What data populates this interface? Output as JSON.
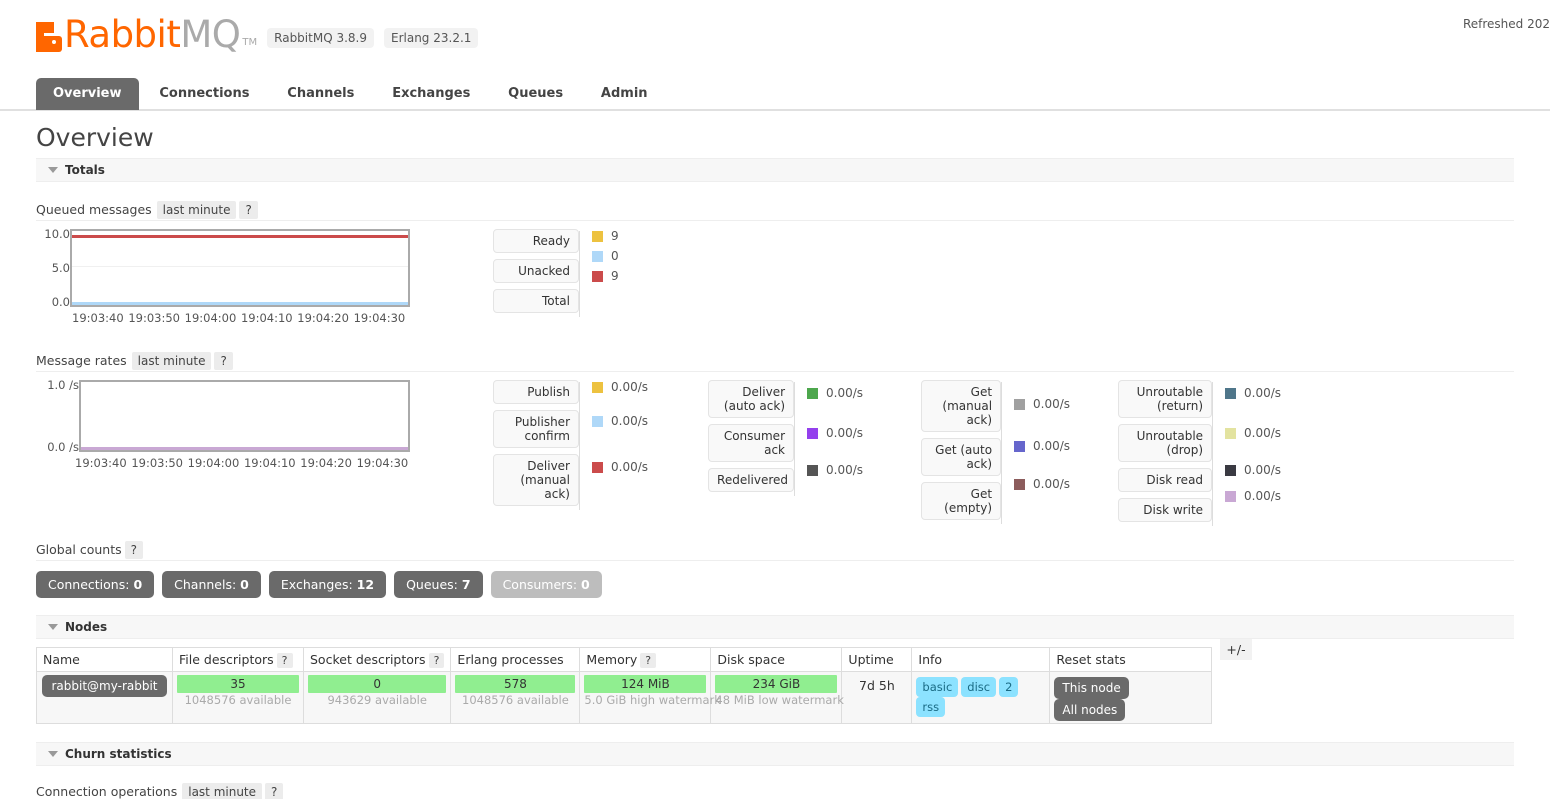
{
  "header": {
    "logo_text_primary": "Rabbit",
    "logo_text_secondary": "MQ",
    "logo_tm": "TM",
    "version_rabbitmq": "RabbitMQ 3.8.9",
    "version_erlang": "Erlang 23.2.1",
    "refreshed": "Refreshed 202"
  },
  "tabs": [
    {
      "label": "Overview",
      "active": true
    },
    {
      "label": "Connections",
      "active": false
    },
    {
      "label": "Channels",
      "active": false
    },
    {
      "label": "Exchanges",
      "active": false
    },
    {
      "label": "Queues",
      "active": false
    },
    {
      "label": "Admin",
      "active": false
    }
  ],
  "page_title": "Overview",
  "sections": {
    "totals": "Totals",
    "nodes": "Nodes",
    "churn": "Churn statistics"
  },
  "queued_messages": {
    "label": "Queued messages",
    "period": "last minute",
    "help": "?",
    "legend": [
      {
        "name": "Ready",
        "value": "9",
        "color": "#edc240"
      },
      {
        "name": "Unacked",
        "value": "0",
        "color": "#afd8f8"
      },
      {
        "name": "Total",
        "value": "9",
        "color": "#cb4b4b"
      }
    ]
  },
  "message_rates": {
    "label": "Message rates",
    "period": "last minute",
    "help": "?",
    "columns": [
      {
        "items": [
          {
            "name": "Publish",
            "value": "0.00/s",
            "color": "#edc240"
          },
          {
            "name": "Publisher\nconfirm",
            "value": "0.00/s",
            "color": "#afd8f8"
          },
          {
            "name": "Deliver\n(manual\nack)",
            "value": "0.00/s",
            "color": "#cb4b4b"
          }
        ]
      },
      {
        "items": [
          {
            "name": "Deliver\n(auto ack)",
            "value": "0.00/s",
            "color": "#4da74d"
          },
          {
            "name": "Consumer\nack",
            "value": "0.00/s",
            "color": "#9440ed"
          },
          {
            "name": "Redelivered",
            "value": "0.00/s",
            "color": "#555555"
          }
        ]
      },
      {
        "items": [
          {
            "name": "Get\n(manual\nack)",
            "value": "0.00/s",
            "color": "#a0a0a0"
          },
          {
            "name": "Get (auto\nack)",
            "value": "0.00/s",
            "color": "#6666cc"
          },
          {
            "name": "Get\n(empty)",
            "value": "0.00/s",
            "color": "#8c5c5c"
          }
        ]
      },
      {
        "items": [
          {
            "name": "Unroutable\n(return)",
            "value": "0.00/s",
            "color": "#4f768a"
          },
          {
            "name": "Unroutable\n(drop)",
            "value": "0.00/s",
            "color": "#e3e3a0"
          },
          {
            "name": "Disk read",
            "value": "0.00/s",
            "color": "#3a3a42"
          },
          {
            "name": "Disk write",
            "value": "0.00/s",
            "color": "#c9a8d4"
          }
        ]
      }
    ]
  },
  "global_counts": {
    "label": "Global counts",
    "help": "?",
    "badges": [
      {
        "label": "Connections:",
        "value": "0",
        "disabled": false
      },
      {
        "label": "Channels:",
        "value": "0",
        "disabled": false
      },
      {
        "label": "Exchanges:",
        "value": "12",
        "disabled": false
      },
      {
        "label": "Queues:",
        "value": "7",
        "disabled": false
      },
      {
        "label": "Consumers:",
        "value": "0",
        "disabled": true
      }
    ]
  },
  "nodes_table": {
    "headers": [
      {
        "label": "Name",
        "help": null
      },
      {
        "label": "File descriptors",
        "help": "?"
      },
      {
        "label": "Socket descriptors",
        "help": "?"
      },
      {
        "label": "Erlang processes",
        "help": null
      },
      {
        "label": "Memory",
        "help": "?"
      },
      {
        "label": "Disk space",
        "help": null
      },
      {
        "label": "Uptime",
        "help": null
      },
      {
        "label": "Info",
        "help": null
      },
      {
        "label": "Reset stats",
        "help": null
      }
    ],
    "expander": "+/-",
    "row": {
      "name": "rabbit@my-rabbit",
      "file_descriptors": {
        "value": "35",
        "sub": "1048576 available"
      },
      "socket_descriptors": {
        "value": "0",
        "sub": "943629 available"
      },
      "erlang_processes": {
        "value": "578",
        "sub": "1048576 available"
      },
      "memory": {
        "value": "124 MiB",
        "sub": "5.0 GiB high watermark"
      },
      "disk_space": {
        "value": "234 GiB",
        "sub": "48 MiB low watermark"
      },
      "uptime": "7d 5h",
      "info": [
        "basic",
        "disc",
        "2",
        "rss"
      ],
      "reset_stats": [
        "This node",
        "All nodes"
      ]
    }
  },
  "churn": {
    "label": "Connection operations",
    "period": "last minute",
    "help": "?"
  },
  "chart_data": [
    {
      "type": "line",
      "title": "Queued messages",
      "xlabel": "",
      "ylabel": "",
      "ylim": [
        0,
        10
      ],
      "yticks": [
        "0.0",
        "5.0",
        "10.0"
      ],
      "x": [
        "19:03:40",
        "19:03:50",
        "19:04:00",
        "19:04:10",
        "19:04:20",
        "19:04:30"
      ],
      "grid": true,
      "legend_position": "right",
      "series": [
        {
          "name": "Ready",
          "color": "#edc240",
          "values": [
            9,
            9,
            9,
            9,
            9,
            9
          ]
        },
        {
          "name": "Unacked",
          "color": "#afd8f8",
          "values": [
            0,
            0,
            0,
            0,
            0,
            0
          ]
        },
        {
          "name": "Total",
          "color": "#cb4b4b",
          "values": [
            9,
            9,
            9,
            9,
            9,
            9
          ]
        }
      ]
    },
    {
      "type": "line",
      "title": "Message rates",
      "xlabel": "",
      "ylabel": "",
      "ylim": [
        0,
        1
      ],
      "yticks": [
        "0.0 /s",
        "1.0 /s"
      ],
      "x": [
        "19:03:40",
        "19:03:50",
        "19:04:00",
        "19:04:10",
        "19:04:20",
        "19:04:30"
      ],
      "grid": false,
      "legend_position": "right",
      "series": [
        {
          "name": "Publish",
          "color": "#edc240",
          "values": [
            0,
            0,
            0,
            0,
            0,
            0
          ]
        },
        {
          "name": "Publisher confirm",
          "color": "#afd8f8",
          "values": [
            0,
            0,
            0,
            0,
            0,
            0
          ]
        },
        {
          "name": "Deliver (manual ack)",
          "color": "#cb4b4b",
          "values": [
            0,
            0,
            0,
            0,
            0,
            0
          ]
        },
        {
          "name": "Deliver (auto ack)",
          "color": "#4da74d",
          "values": [
            0,
            0,
            0,
            0,
            0,
            0
          ]
        },
        {
          "name": "Consumer ack",
          "color": "#9440ed",
          "values": [
            0,
            0,
            0,
            0,
            0,
            0
          ]
        },
        {
          "name": "Redelivered",
          "color": "#555555",
          "values": [
            0,
            0,
            0,
            0,
            0,
            0
          ]
        },
        {
          "name": "Get (manual ack)",
          "color": "#a0a0a0",
          "values": [
            0,
            0,
            0,
            0,
            0,
            0
          ]
        },
        {
          "name": "Get (auto ack)",
          "color": "#6666cc",
          "values": [
            0,
            0,
            0,
            0,
            0,
            0
          ]
        },
        {
          "name": "Get (empty)",
          "color": "#8c5c5c",
          "values": [
            0,
            0,
            0,
            0,
            0,
            0
          ]
        },
        {
          "name": "Unroutable (return)",
          "color": "#4f768a",
          "values": [
            0,
            0,
            0,
            0,
            0,
            0
          ]
        },
        {
          "name": "Unroutable (drop)",
          "color": "#e3e3a0",
          "values": [
            0,
            0,
            0,
            0,
            0,
            0
          ]
        },
        {
          "name": "Disk read",
          "color": "#3a3a42",
          "values": [
            0,
            0,
            0,
            0,
            0,
            0
          ]
        },
        {
          "name": "Disk write",
          "color": "#c9a8d4",
          "values": [
            0,
            0,
            0,
            0,
            0,
            0
          ]
        }
      ]
    }
  ]
}
